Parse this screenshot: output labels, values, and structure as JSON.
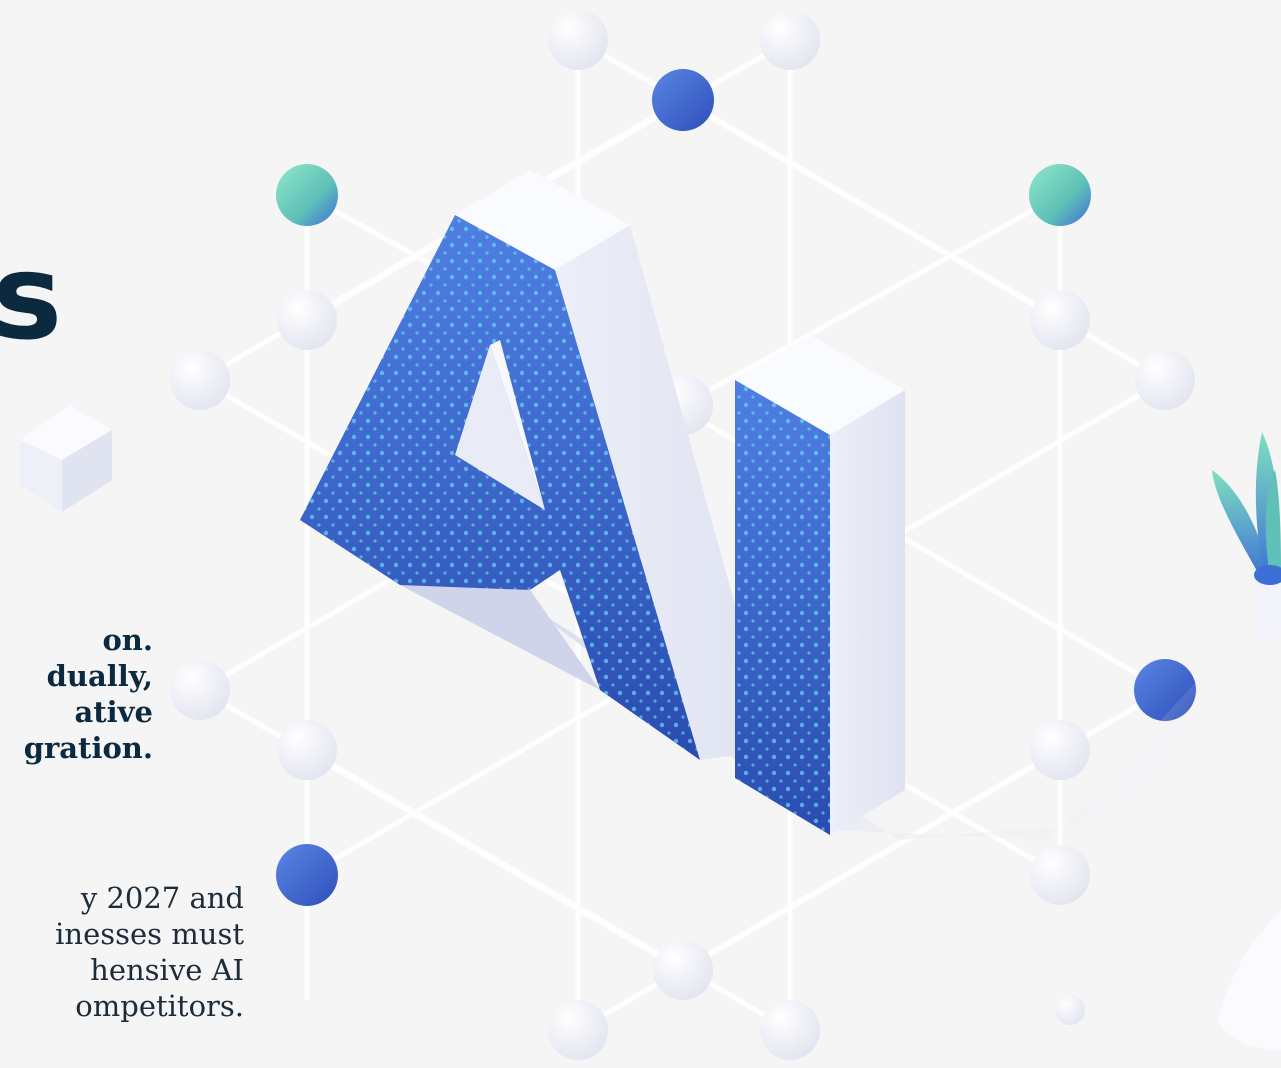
{
  "hero": {
    "headline_fragment": "s",
    "lead_lines": [
      "on.",
      "dually,",
      "ative",
      "gration."
    ],
    "body_lines": [
      "y 2027 and",
      "inesses must",
      "hensive AI",
      "ompetitors."
    ],
    "illustration_letters": "AI"
  },
  "colors": {
    "background": "#f5f5f6",
    "heading": "#0b2a3f",
    "letter_blue": "#3d6fd6",
    "dot_cyan": "#5fd0f5",
    "node_teal": "#7fe0c0"
  },
  "icons": [
    "network-node-icon",
    "cube-icon",
    "plant-icon",
    "ai-letters-icon"
  ]
}
